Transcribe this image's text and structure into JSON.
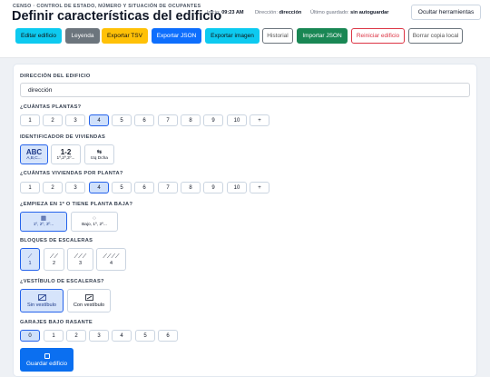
{
  "header": {
    "eyebrow": "CENSO · CONTROL DE ESTADO, NÚMERO Y SITUACIÓN DE OCUPANTES",
    "title": "Definir características del edificio",
    "start_label": "Inicio:",
    "start_value": "09:23 AM",
    "address_label": "Dirección:",
    "address_value": "dirección",
    "saved_label": "Último guardado:",
    "saved_value": "sin autoguardar",
    "hide_tools": "Ocultar herramientas"
  },
  "toolbar": {
    "edit": "Editar edificio",
    "legend": "Leyenda",
    "export_tsv": "Exportar TSV",
    "export_json": "Exportar JSON",
    "export_image": "Exportar imagen",
    "history": "Historial",
    "import_json": "Importar JSON",
    "reset": "Reiniciar edificio",
    "delete_backup": "Borrar copia local"
  },
  "colors": {
    "cyan": "#0dcaf0",
    "gray": "#6c757d",
    "amber": "#ffc107",
    "blue": "#0d6efd",
    "green": "#198754",
    "red": "#dc3545",
    "selected": "#2563eb"
  },
  "form": {
    "address": {
      "label": "DIRECCIÓN DEL EDIFICIO",
      "value": "dirección"
    },
    "floors": {
      "label": "¿CUÁNTAS PLANTAS?",
      "options": [
        "1",
        "2",
        "3",
        "4",
        "5",
        "6",
        "7",
        "8",
        "9",
        "10",
        "+"
      ],
      "selected": "4"
    },
    "dwelling_id": {
      "label": "IDENTIFICADOR DE VIVIENDAS",
      "options": [
        {
          "main": "ABC",
          "sub": "A,B,C..."
        },
        {
          "main": "1-2",
          "sub": "1º,2º,3º..."
        },
        {
          "main": "⇆",
          "sub": "Izq Dcha"
        }
      ],
      "selected": "ABC"
    },
    "per_floor": {
      "label": "¿CUÁNTAS VIVIENDAS POR PLANTA?",
      "options": [
        "1",
        "2",
        "3",
        "4",
        "5",
        "6",
        "7",
        "8",
        "9",
        "10",
        "+"
      ],
      "selected": "4"
    },
    "start_floor": {
      "label": "¿EMPIEZA EN 1º O TIENE PLANTA BAJA?",
      "options": [
        {
          "icon": "building-icon",
          "sub": "1º, 2º, 3º..."
        },
        {
          "icon": "circle-icon",
          "sub": "Bajo, 1º, 2º..."
        }
      ],
      "selected": "1º, 2º, 3º..."
    },
    "stairs": {
      "label": "BLOQUES DE ESCALERAS",
      "options": [
        {
          "icon": "⟋",
          "sub": "1"
        },
        {
          "icon": "⟋⟋",
          "sub": "2"
        },
        {
          "icon": "⟋⟋⟋",
          "sub": "3"
        },
        {
          "icon": "⟋⟋⟋⟋",
          "sub": "4"
        }
      ],
      "selected": "1"
    },
    "lobby": {
      "label": "¿VESTÍBULO DE ESCALERAS?",
      "options": [
        {
          "icon": "lobby-off-icon",
          "sub": "Sin vestíbulo"
        },
        {
          "icon": "lobby-on-icon",
          "sub": "Con vestíbulo"
        }
      ],
      "selected": "Sin vestíbulo"
    },
    "garages": {
      "label": "GARAJES BAJO RASANTE",
      "options": [
        "0",
        "1",
        "2",
        "3",
        "4",
        "5",
        "6"
      ],
      "selected": "0"
    },
    "save": "Guardar edificio"
  }
}
